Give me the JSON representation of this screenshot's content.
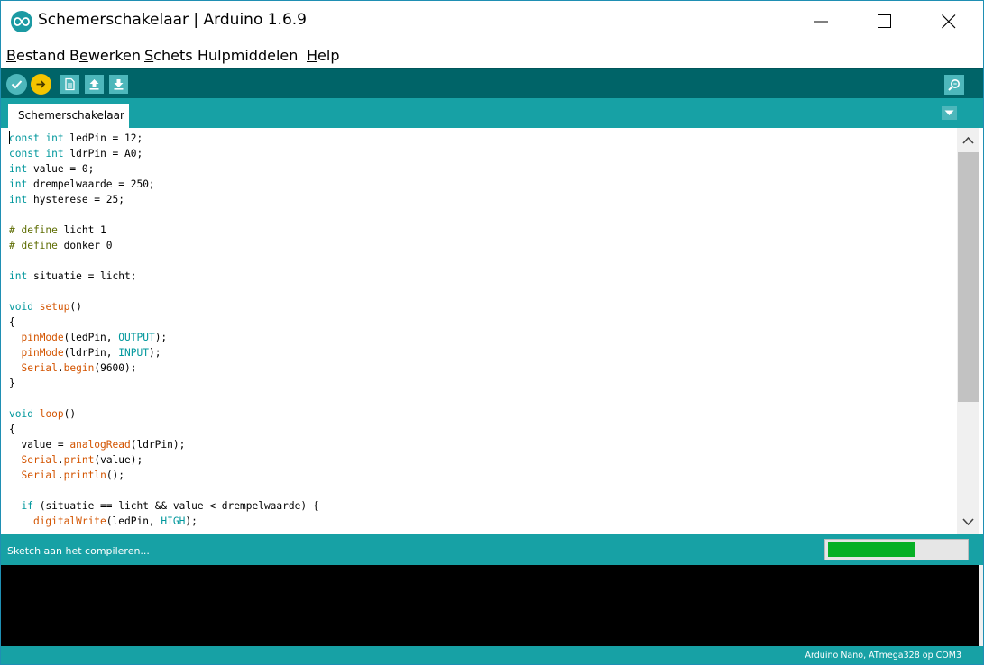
{
  "window": {
    "title": "Schemerschakelaar | Arduino 1.6.9",
    "app_icon": "arduino-infinity-icon",
    "controls": [
      "minimize-icon",
      "maximize-icon",
      "close-icon"
    ]
  },
  "menu": {
    "items": [
      {
        "label": "Bestand",
        "mnemonic_index": 0
      },
      {
        "label": "Bewerken",
        "mnemonic_index": 1
      },
      {
        "label": "Schets",
        "mnemonic_index": 0
      },
      {
        "label": "Hulpmiddelen",
        "mnemonic_index": -1
      },
      {
        "label": "Help",
        "mnemonic_index": 0
      }
    ]
  },
  "toolbar": {
    "buttons": [
      "verify-icon",
      "upload-icon",
      "new-icon",
      "open-icon",
      "save-icon"
    ],
    "right_button": "serial-monitor-icon"
  },
  "tabs": {
    "active": "Schemerschakelaar",
    "menu_icon": "tab-menu-icon"
  },
  "editor": {
    "lines": [
      [
        [
          "kw",
          "const"
        ],
        [
          "t",
          " "
        ],
        [
          "kw",
          "int"
        ],
        [
          "t",
          " ledPin = 12;"
        ]
      ],
      [
        [
          "kw",
          "const"
        ],
        [
          "t",
          " "
        ],
        [
          "kw",
          "int"
        ],
        [
          "t",
          " ldrPin = A0;"
        ]
      ],
      [
        [
          "kw",
          "int"
        ],
        [
          "t",
          " value = 0;"
        ]
      ],
      [
        [
          "kw",
          "int"
        ],
        [
          "t",
          " drempelwaarde = 250;"
        ]
      ],
      [
        [
          "kw",
          "int"
        ],
        [
          "t",
          " hysterese = 25;"
        ]
      ],
      [],
      [
        [
          "dir",
          "# define"
        ],
        [
          "t",
          " licht 1"
        ]
      ],
      [
        [
          "dir",
          "# define"
        ],
        [
          "t",
          " donker 0"
        ]
      ],
      [],
      [
        [
          "kw",
          "int"
        ],
        [
          "t",
          " situatie = licht;"
        ]
      ],
      [],
      [
        [
          "kw",
          "void"
        ],
        [
          "t",
          " "
        ],
        [
          "fn",
          "setup"
        ],
        [
          "t",
          "()"
        ]
      ],
      [
        [
          "t",
          "{"
        ]
      ],
      [
        [
          "t",
          "  "
        ],
        [
          "fn",
          "pinMode"
        ],
        [
          "t",
          "(ledPin, "
        ],
        [
          "cst",
          "OUTPUT"
        ],
        [
          "t",
          ");"
        ]
      ],
      [
        [
          "t",
          "  "
        ],
        [
          "fn",
          "pinMode"
        ],
        [
          "t",
          "(ldrPin, "
        ],
        [
          "cst",
          "INPUT"
        ],
        [
          "t",
          ");"
        ]
      ],
      [
        [
          "t",
          "  "
        ],
        [
          "fn",
          "Serial"
        ],
        [
          "t",
          "."
        ],
        [
          "fn",
          "begin"
        ],
        [
          "t",
          "(9600);"
        ]
      ],
      [
        [
          "t",
          "}"
        ]
      ],
      [],
      [
        [
          "kw",
          "void"
        ],
        [
          "t",
          " "
        ],
        [
          "fn",
          "loop"
        ],
        [
          "t",
          "()"
        ]
      ],
      [
        [
          "t",
          "{"
        ]
      ],
      [
        [
          "t",
          "  value = "
        ],
        [
          "fn",
          "analogRead"
        ],
        [
          "t",
          "(ldrPin);"
        ]
      ],
      [
        [
          "t",
          "  "
        ],
        [
          "fn",
          "Serial"
        ],
        [
          "t",
          "."
        ],
        [
          "fn",
          "print"
        ],
        [
          "t",
          "(value);"
        ]
      ],
      [
        [
          "t",
          "  "
        ],
        [
          "fn",
          "Serial"
        ],
        [
          "t",
          "."
        ],
        [
          "fn",
          "println"
        ],
        [
          "t",
          "();"
        ]
      ],
      [],
      [
        [
          "t",
          "  "
        ],
        [
          "kw",
          "if"
        ],
        [
          "t",
          " (situatie == licht "
        ],
        [
          "t",
          "&&"
        ],
        [
          "t",
          " value < drempelwaarde) {"
        ]
      ],
      [
        [
          "t",
          "    "
        ],
        [
          "fn",
          "digitalWrite"
        ],
        [
          "t",
          "(ledPin, "
        ],
        [
          "cst",
          "HIGH"
        ],
        [
          "t",
          ");"
        ]
      ]
    ]
  },
  "status": {
    "message": "Sketch aan het compileren...",
    "progress": 0.63
  },
  "footer": {
    "board": "Arduino Nano, ATmega328 op COM3"
  },
  "colors": {
    "toolbar_bg": "#006468",
    "strip_bg": "#17a1a5",
    "button_bg": "#4db7bb",
    "upload_bg": "#f5c400",
    "keyword": "#00979c",
    "function": "#d35400",
    "directive": "#5e6d03",
    "progress_fill": "#06b025",
    "console_bg": "#000000"
  }
}
